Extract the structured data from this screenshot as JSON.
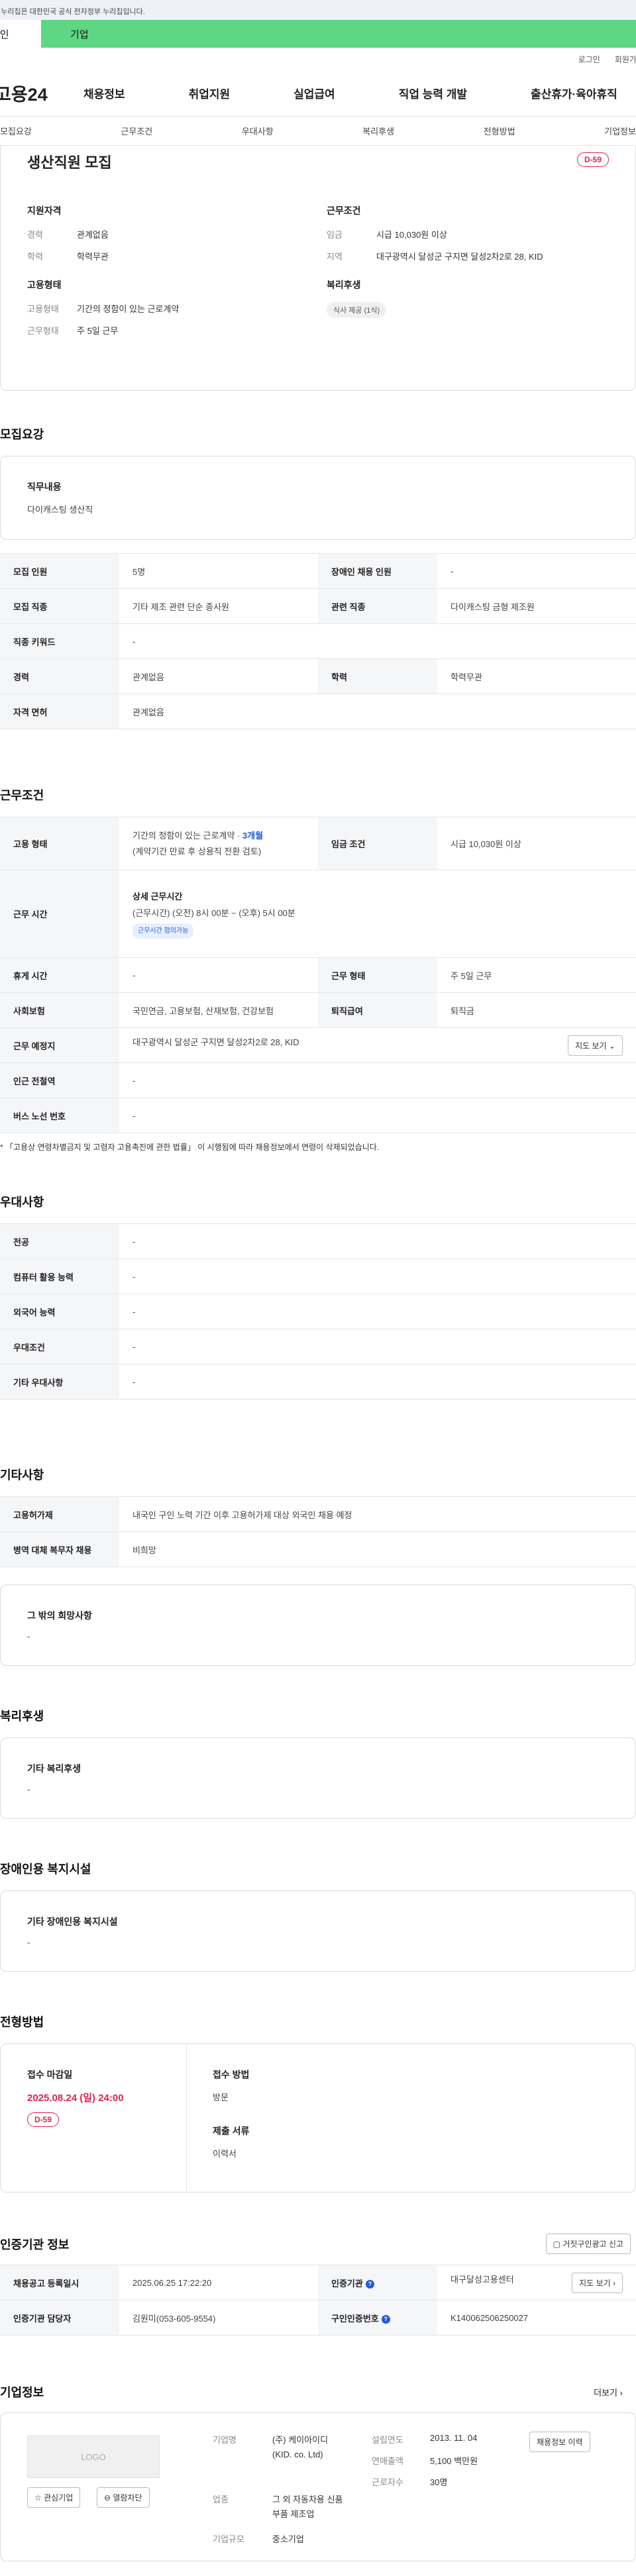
{
  "gov_banner": "이 누리집은 대한민국 공식 전자정부 누리집입니다.",
  "user_tabs": {
    "personal": "개인",
    "company": "기업"
  },
  "utility": {
    "login": "로그인",
    "signup": "회원가입"
  },
  "header": {
    "logo": "고용24",
    "menu": [
      "채용정보",
      "취업지원",
      "실업급여",
      "직업 능력 개발",
      "출산휴가·육아휴직"
    ]
  },
  "anchor_nav": [
    "모집요강",
    "근무조건",
    "우대사항",
    "복리후생",
    "전형방법",
    "기업정보"
  ],
  "summary": {
    "title": "생산직원 모집",
    "dday": "D-59",
    "qualification": {
      "heading": "지원자격",
      "career_k": "경력",
      "career_v": "관계없음",
      "edu_k": "학력",
      "edu_v": "학력무관"
    },
    "employment": {
      "heading": "고용형태",
      "type_k": "고용형태",
      "type_v": "기간의 정함이 있는 근로계약",
      "shift_k": "근무형태",
      "shift_v": "주 5일 근무"
    },
    "conditions": {
      "heading": "근무조건",
      "wage_k": "임금",
      "wage_v": "시급 10,030원 이상",
      "area_k": "지역",
      "area_v": "대구광역시 달성군 구지면 달성2차2로 28, KID"
    },
    "welfare": {
      "heading": "복리후생",
      "chip": "식사 제공 (1식)"
    }
  },
  "recruit": {
    "title": "모집요강",
    "duty_label": "직무내용",
    "duty_value": "다이캐스팅 생산직",
    "rows": {
      "headcount_k": "모집 인원",
      "headcount_v": "5명",
      "disabled_k": "장애인 채용 인원",
      "disabled_v": "-",
      "occupation_k": "모집 직종",
      "occupation_v": "기타 제조 관련 단순 종사원",
      "related_k": "관련 직종",
      "related_v": "다이캐스팅 금형 제조원",
      "keyword_k": "직종 키워드",
      "keyword_v": "-",
      "career_k": "경력",
      "career_v": "관계없음",
      "edu_k": "학력",
      "edu_v": "학력무관",
      "license_k": "자격 면허",
      "license_v": "관계없음"
    }
  },
  "work": {
    "title": "근무조건",
    "type_k": "고용 형태",
    "type_v1": "기간의 정함이 있는 근로계약 · ",
    "type_v1_blue": "3개월",
    "type_v2": "(계약기간 만료 후 상용직 전환 검토)",
    "wage_k": "임금 조건",
    "wage_v": "시급 10,030원 이상",
    "hours_k": "근무 시간",
    "hours_head": "상세 근무시간",
    "hours_v": "(근무시간) (오전) 8시 00분 ~ (오후) 5시 00분",
    "hours_tag": "근무시간 협의가능",
    "break_k": "휴게 시간",
    "break_v": "-",
    "shift_k": "근무 형태",
    "shift_v": "주 5일 근무",
    "insurance_k": "사회보험",
    "insurance_v": "국민연금, 고용보험, 산재보험, 건강보험",
    "severance_k": "퇴직급여",
    "severance_v": "퇴직금",
    "location_k": "근무 예정지",
    "location_v": "대구광역시 달성군 구지면 달성2차2로 28, KID",
    "map_btn": "지도 보기",
    "subway_k": "인근 전철역",
    "subway_v": "-",
    "bus_k": "버스 노선 번호",
    "bus_v": "-",
    "note": "* 「고용상 연령차별금지 및 고령자 고용촉진에 관한 법률」 이 시행됨에 따라 채용정보에서 연령이 삭제되었습니다."
  },
  "preference": {
    "title": "우대사항",
    "major_k": "전공",
    "major_v": "-",
    "computer_k": "컴퓨터 활용 능력",
    "computer_v": "-",
    "language_k": "외국어 능력",
    "language_v": "-",
    "cond_k": "우대조건",
    "cond_v": "-",
    "etc_k": "기타 우대사항",
    "etc_v": "-"
  },
  "other": {
    "title": "기타사항",
    "permit_k": "고용허가제",
    "permit_v": "내국인 구인 노력 기간 이후 고용허가제 대상 외국인 채용 예정",
    "military_k": "병역 대체 복무자 채용",
    "military_v": "비희망",
    "wish_label": "그 밖의 희망사항",
    "wish_value": "-"
  },
  "benefit": {
    "title": "복리후생",
    "label": "기타 복리후생",
    "value": "-"
  },
  "disability": {
    "title": "장애인용 복지시설",
    "label": "기타 장애인용 복지시설",
    "value": "-"
  },
  "selection": {
    "title": "전형방법",
    "deadline_label": "접수 마감일",
    "deadline": "2025.08.24 (일) 24:00",
    "dday": "D-59",
    "method_label": "접수 방법",
    "method": "방문",
    "docs_label": "제출 서류",
    "docs": "이력서"
  },
  "agency": {
    "title": "인증기관 정보",
    "report_btn": "거짓구인광고 신고",
    "reg_k": "채용공고 등록일시",
    "reg_v": "2025.06.25 17:22:20",
    "agency_k": "인증기관",
    "agency_v": "대구달성고용센터",
    "manager_k": "인증기관 담당자",
    "manager_v": "김원미(053-605-9554)",
    "number_k": "구인인증번호",
    "number_v": "K140062506250027",
    "map_btn": "지도 보기"
  },
  "company": {
    "title": "기업정보",
    "more": "더보기",
    "logo_text": "LOGO",
    "fav_btn": "관심기업",
    "block_btn": "열람차단",
    "name_k": "기업명",
    "name_v": "(주) 케이아이디 (KID. co. Ltd)",
    "industry_k": "업종",
    "industry_v": "그 외 자동차용 신품 부품 제조업",
    "size_k": "기업규모",
    "size_v": "중소기업",
    "founded_k": "설립연도",
    "founded_v": "2013. 11. 04",
    "sales_k": "연매출액",
    "sales_v": "5,100 백만원",
    "staff_k": "근로자수",
    "staff_v": "30명",
    "history_btn": "채용정보 이력"
  }
}
